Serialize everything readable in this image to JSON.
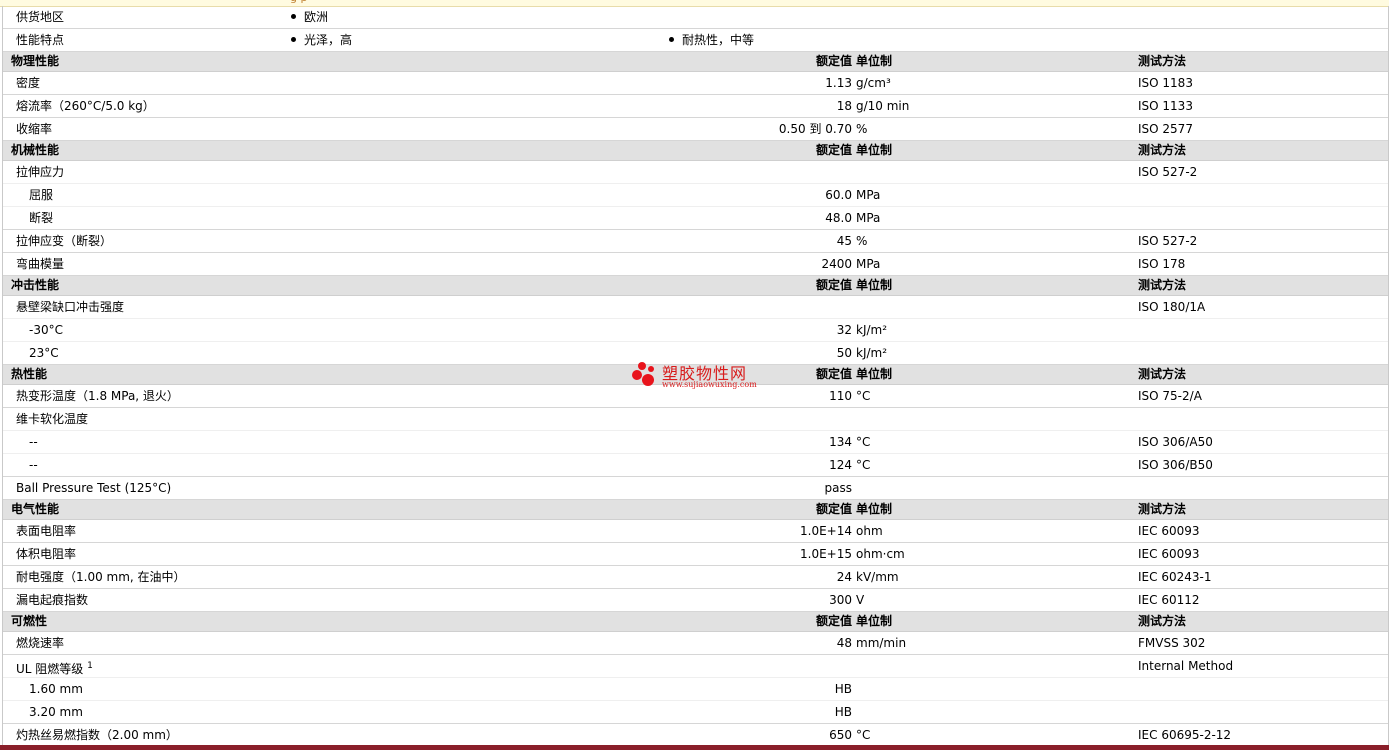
{
  "top_strip_text": "g  p",
  "meta": {
    "supply_region": {
      "label": "供货地区",
      "values": [
        "欧洲"
      ]
    },
    "features": {
      "label": "性能特点",
      "values": [
        "光泽，高",
        "耐热性，中等"
      ]
    }
  },
  "headers": {
    "value": "额定值",
    "unit": "单位制",
    "test": "测试方法"
  },
  "sections": {
    "physical": {
      "title": "物理性能",
      "rows": [
        {
          "name": "密度",
          "value": "1.13",
          "unit": "g/cm³",
          "test": "ISO 1183"
        },
        {
          "name": "熔流率（260°C/5.0 kg）",
          "value": "18",
          "unit": "g/10 min",
          "test": "ISO 1133"
        },
        {
          "name": "收缩率",
          "value": "0.50 到  0.70",
          "unit": "%",
          "test": "ISO 2577"
        }
      ]
    },
    "mechanical": {
      "title": "机械性能",
      "rows": [
        {
          "name": "拉伸应力",
          "value": "",
          "unit": "",
          "test": "ISO 527-2"
        },
        {
          "name": "屈服",
          "value": "60.0",
          "unit": "MPa",
          "test": ""
        },
        {
          "name": "断裂",
          "value": "48.0",
          "unit": "MPa",
          "test": ""
        },
        {
          "name": "拉伸应变（断裂）",
          "value": "45",
          "unit": "%",
          "test": "ISO 527-2"
        },
        {
          "name": "弯曲模量",
          "value": "2400",
          "unit": "MPa",
          "test": "ISO 178"
        }
      ]
    },
    "impact": {
      "title": "冲击性能",
      "rows": [
        {
          "name": "悬壁梁缺口冲击强度",
          "value": "",
          "unit": "",
          "test": "ISO 180/1A"
        },
        {
          "name": "-30°C",
          "value": "32",
          "unit": "kJ/m²",
          "test": ""
        },
        {
          "name": "23°C",
          "value": "50",
          "unit": "kJ/m²",
          "test": ""
        }
      ]
    },
    "thermal": {
      "title": "热性能",
      "rows": [
        {
          "name": "热变形温度（1.8 MPa, 退火）",
          "value": "110",
          "unit": "°C",
          "test": "ISO 75-2/A"
        },
        {
          "name": "维卡软化温度",
          "value": "",
          "unit": "",
          "test": ""
        },
        {
          "name": "--",
          "value": "134",
          "unit": "°C",
          "test": "ISO 306/A50"
        },
        {
          "name": "--",
          "value": "124",
          "unit": "°C",
          "test": "ISO 306/B50"
        },
        {
          "name": "Ball Pressure Test (125°C)",
          "value": "pass",
          "unit": "",
          "test": ""
        }
      ]
    },
    "electrical": {
      "title": "电气性能",
      "rows": [
        {
          "name": "表面电阻率",
          "value": "1.0E+14",
          "unit": "ohm",
          "test": "IEC 60093"
        },
        {
          "name": "体积电阻率",
          "value": "1.0E+15",
          "unit": "ohm·cm",
          "test": "IEC 60093"
        },
        {
          "name": "耐电强度（1.00 mm, 在油中）",
          "value": "24",
          "unit": "kV/mm",
          "test": "IEC 60243-1"
        },
        {
          "name": "漏电起痕指数",
          "value": "300",
          "unit": "V",
          "test": "IEC 60112"
        }
      ]
    },
    "flammability": {
      "title": "可燃性",
      "rows": [
        {
          "name": "燃烧速率",
          "value": "48",
          "unit": "mm/min",
          "test": "FMVSS 302"
        },
        {
          "name": "UL 阻燃等级",
          "footnote": "1",
          "value": "",
          "unit": "",
          "test": "Internal Method"
        },
        {
          "name": "1.60 mm",
          "value": "HB",
          "unit": "",
          "test": ""
        },
        {
          "name": "3.20 mm",
          "value": "HB",
          "unit": "",
          "test": ""
        },
        {
          "name": "灼热丝易燃指数（2.00 mm）",
          "value": "650",
          "unit": "°C",
          "test": "IEC 60695-2-12"
        }
      ]
    }
  },
  "watermark": {
    "title": "塑胶物性网",
    "url": "www.sujiaowuxing.com",
    "color": "#e8141c"
  },
  "colors": {
    "header_bg": "#e1e1e1",
    "bottom_bar": "#8a1f2a"
  }
}
